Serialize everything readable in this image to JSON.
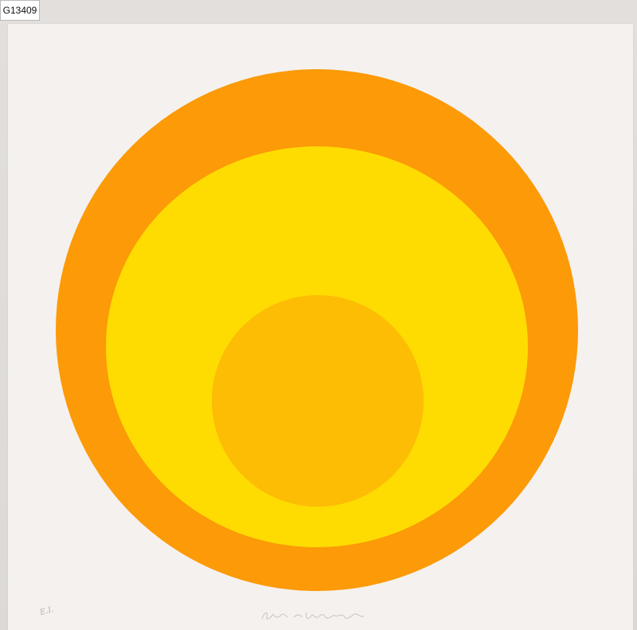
{
  "catalog_label": "G13409",
  "artwork": {
    "colors": {
      "paper": "#f5f1ef",
      "outer_ring": "#fc9a07",
      "middle_disc": "#fedc02",
      "inner_disc": "#fdbd04"
    }
  },
  "inscription": {
    "edition": "E.I."
  }
}
